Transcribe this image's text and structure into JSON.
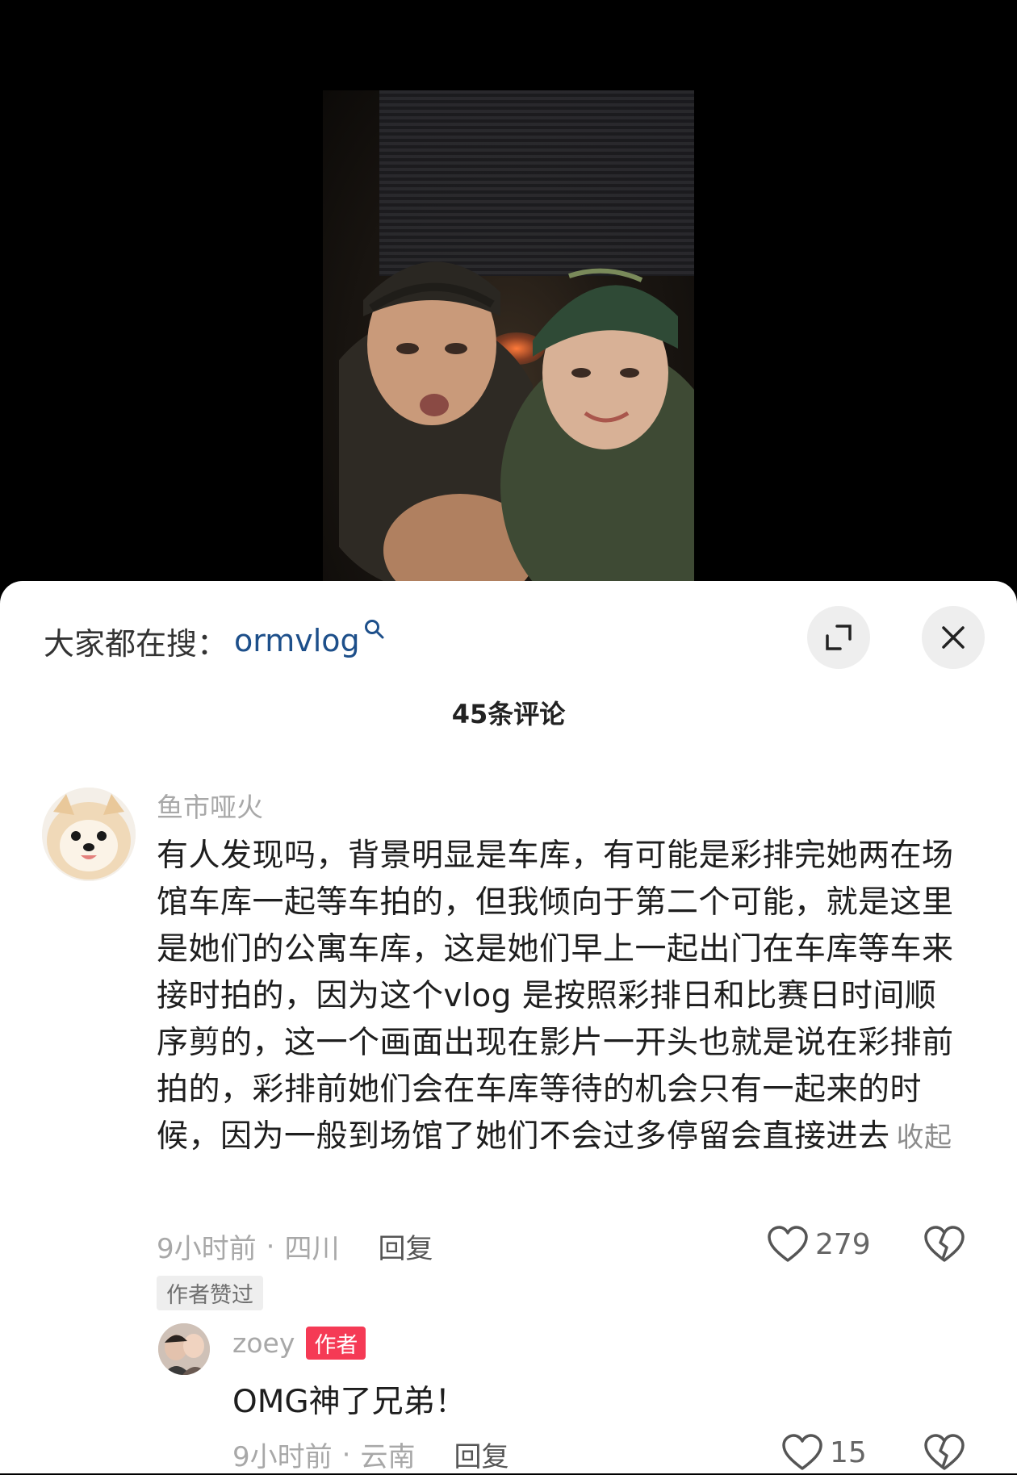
{
  "search": {
    "label": "大家都在搜：",
    "term": "ormvlog"
  },
  "comments_header": {
    "count_label": "45条评论"
  },
  "comment": {
    "username": "鱼市哑火",
    "text": "有人发现吗，背景明显是车库，有可能是彩排完她两在场馆车库一起等车拍的，但我倾向于第二个可能，就是这里是她们的公寓车库，这是她们早上一起出门在车库等车来接时拍的，因为这个vlog 是按照彩排日和比赛日时间顺序剪的，这一个画面出现在影片一开头也就是说在彩排前拍的，彩排前她们会在车库等待的机会只有一起来的时候，因为一般到场馆了她们不会过多停留会直接进去",
    "collapse_label": "收起",
    "time": "9小时前",
    "separator": "·",
    "location": "四川",
    "reply_label": "回复",
    "likes": "279",
    "author_liked_tag": "作者赞过"
  },
  "reply": {
    "username": "zoey",
    "badge": "作者",
    "text": "OMG神了兄弟！",
    "time": "9小时前",
    "separator": "·",
    "location": "云南",
    "reply_label": "回复",
    "likes": "15"
  },
  "colors": {
    "search_term": "#1d4f8a",
    "author_badge": "#f53a55",
    "sheet_bg": "#ffffff",
    "video_bg": "#000000"
  }
}
